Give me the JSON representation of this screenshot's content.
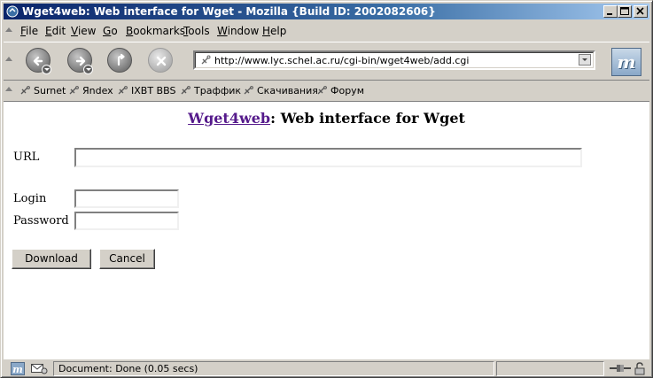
{
  "window": {
    "title": "Wget4web: Web interface for Wget - Mozilla {Build ID: 2002082606}",
    "controls": [
      "minimize",
      "maximize",
      "close"
    ]
  },
  "menubar": {
    "items": [
      {
        "label": "File",
        "key": "F",
        "rest": "ile"
      },
      {
        "label": "Edit",
        "key": "E",
        "rest": "dit"
      },
      {
        "label": "View",
        "key": "V",
        "rest": "iew"
      },
      {
        "label": "Go",
        "key": "G",
        "rest": "o"
      },
      {
        "label": "Bookmarks",
        "key": "B",
        "rest": "ookmarks"
      },
      {
        "label": "Tools",
        "key": "T",
        "rest": "ools"
      },
      {
        "label": "Window",
        "key": "W",
        "rest": "indow"
      },
      {
        "label": "Help",
        "key": "H",
        "rest": "elp"
      }
    ]
  },
  "navigation": {
    "buttons": [
      "back",
      "forward",
      "reload",
      "stop"
    ],
    "url": "http://www.lyc.schel.ac.ru/cgi-bin/wget4web/add.cgi",
    "throbber_icon": "mozilla-m-icon"
  },
  "bookmarks": {
    "items": [
      "Surnet",
      "Яndex",
      "IXBT BBS",
      "Траффик",
      "Скачивания",
      "Форум"
    ]
  },
  "page": {
    "heading_link": "Wget4web",
    "heading_rest": ": Web interface for Wget",
    "url_label": "URL",
    "url_value": "",
    "login_label": "Login",
    "login_value": "",
    "password_label": "Password",
    "password_value": "",
    "download_button": "Download",
    "cancel_button": "Cancel"
  },
  "status": {
    "text": "Document: Done (0.05 secs)"
  },
  "colors": {
    "titlebar_start": "#0a246a",
    "titlebar_end": "#a6caf0",
    "chrome": "#d4d0c8",
    "visited_link": "#551a8b"
  }
}
